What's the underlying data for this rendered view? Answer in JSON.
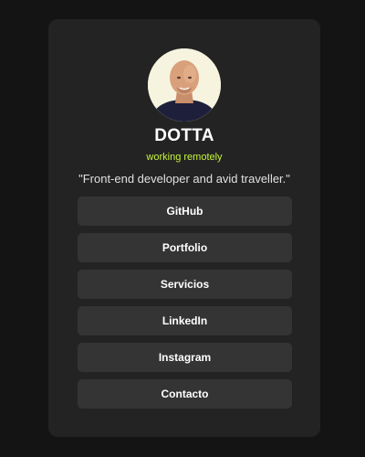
{
  "profile": {
    "name": "DOTTA",
    "location": "working remotely",
    "bio": "\"Front-end developer and avid traveller.\"",
    "avatar_icon": "person-photo-icon"
  },
  "links": [
    {
      "label": "GitHub"
    },
    {
      "label": "Portfolio"
    },
    {
      "label": "Servicios"
    },
    {
      "label": "LinkedIn"
    },
    {
      "label": "Instagram"
    },
    {
      "label": "Contacto"
    }
  ],
  "colors": {
    "background": "#141414",
    "card": "#232323",
    "button": "#343434",
    "accent": "#c6f43c",
    "text": "#ffffff"
  }
}
